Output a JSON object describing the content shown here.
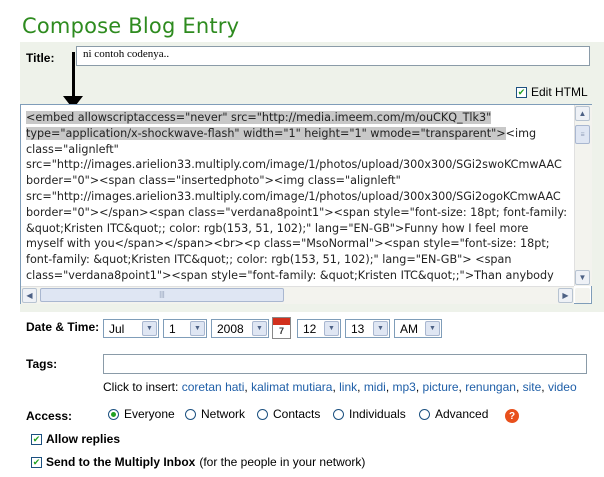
{
  "page": {
    "title": "Compose Blog Entry"
  },
  "title_field": {
    "label": "Title:",
    "value": "ni contoh codenya.."
  },
  "edit_html": {
    "label": "Edit HTML",
    "checked": true
  },
  "editor": {
    "selected_text": "<embed allowscriptaccess=\"never\" src=\"http://media.imeem.com/m/ouCKQ_Tlk3\"\ntype=\"application/x-shockwave-flash\" width=\"1\" height=\"1\" wmode=\"transparent\">",
    "rest_text": "<img\nclass=\"alignleft\"\nsrc=\"http://images.arielion33.multiply.com/image/1/photos/upload/300x300/SGi2swoKCmwAAC\nborder=\"0\"><span class=\"insertedphoto\"><img class=\"alignleft\"\nsrc=\"http://images.arielion33.multiply.com/image/1/photos/upload/300x300/SGi2ogoKCmwAAC\nborder=\"0\"></span><span class=\"verdana8point1\"><span style=\"font-size: 18pt; font-family:\n&quot;Kristen ITC&quot;; color: rgb(153, 51, 102);\" lang=\"EN-GB\">Funny how I feel more\nmyself with you</span></span><br><p class=\"MsoNormal\"><span style=\"font-size: 18pt;\nfont-family: &quot;Kristen ITC&quot;; color: rgb(153, 51, 102);\" lang=\"EN-GB\"> <span\nclass=\"verdana8point1\"><span style=\"font-family: &quot;Kristen ITC&quot;;\">Than anybody"
  },
  "datetime": {
    "label": "Date & Time:",
    "month": "Jul",
    "day": "1",
    "year": "2008",
    "calendar_day": "7",
    "hour": "12",
    "minute": "13",
    "ampm": "AM"
  },
  "tags": {
    "label": "Tags:",
    "value": "",
    "insert_prefix": "Click to insert:",
    "suggestions": [
      "coretan hati",
      "kalimat mutiara",
      "link",
      "midi",
      "mp3",
      "picture",
      "renungan",
      "site",
      "video"
    ]
  },
  "access": {
    "label": "Access:",
    "options": [
      "Everyone",
      "Network",
      "Contacts",
      "Individuals",
      "Advanced"
    ],
    "selected": "Everyone",
    "help_icon": "help-icon"
  },
  "allow_replies": {
    "label": "Allow replies",
    "checked": true
  },
  "send_inbox": {
    "label": "Send to the Multiply Inbox",
    "note": "(for the people in your network)",
    "checked": true
  },
  "colors": {
    "title_green": "#2e8b1f",
    "panel_bg": "#eef2ea",
    "link_blue": "#1f5fa8",
    "check_green": "#21a121",
    "help_orange": "#e8501c"
  }
}
